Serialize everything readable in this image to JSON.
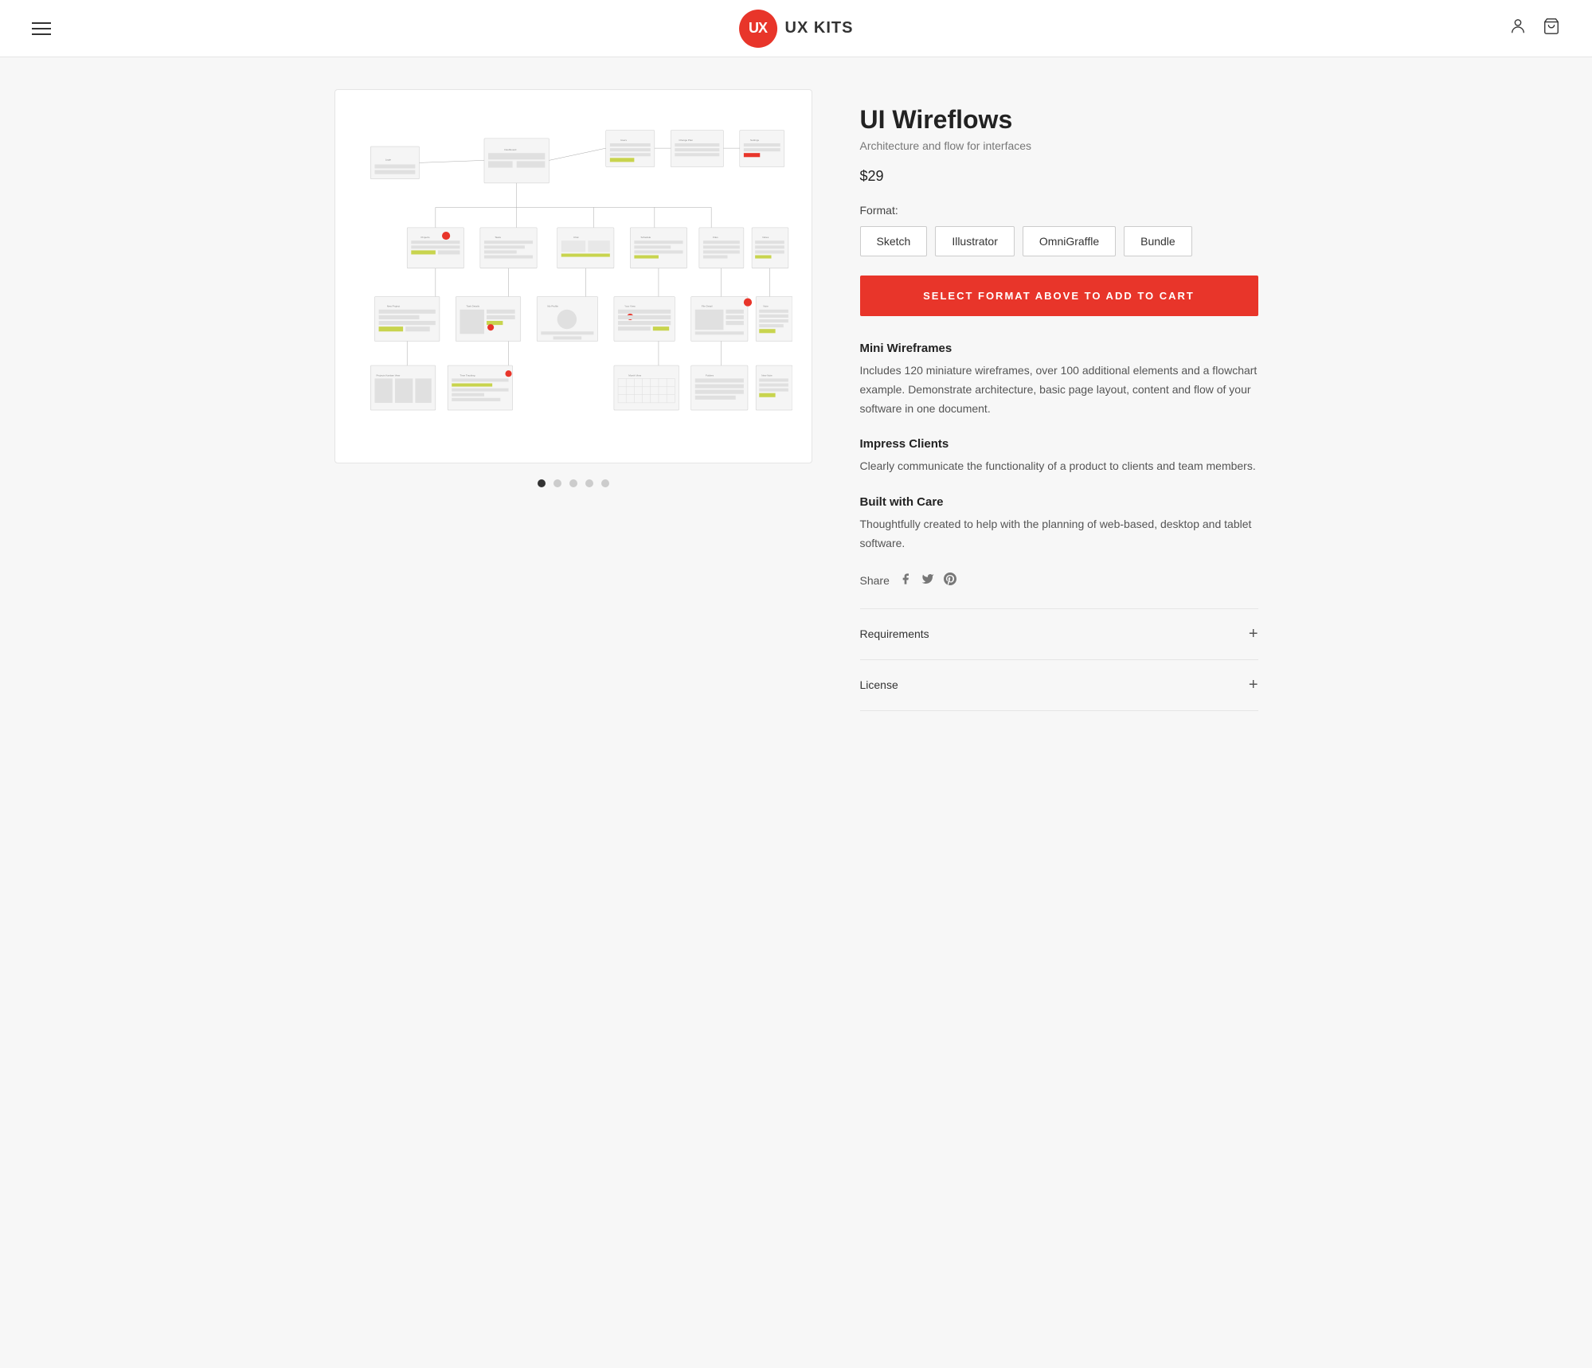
{
  "header": {
    "logo_text": "UX KITS",
    "logo_initials": "UX"
  },
  "product": {
    "title": "UI Wireflows",
    "subtitle": "Architecture and flow for interfaces",
    "price": "$29",
    "format_label": "Format:",
    "formats": [
      "Sketch",
      "Illustrator",
      "OmniGraffle",
      "Bundle"
    ],
    "add_to_cart_label": "SELECT FORMAT ABOVE TO ADD TO CART",
    "features": [
      {
        "title": "Mini Wireframes",
        "description": "Includes 120 miniature wireframes, over 100 additional elements and a flowchart example. Demonstrate architecture, basic page layout, content and flow of your software in one document."
      },
      {
        "title": "Impress Clients",
        "description": "Clearly communicate the functionality of a product to clients and team members."
      },
      {
        "title": "Built with Care",
        "description": "Thoughtfully created to help with the planning of web-based, desktop and tablet software."
      }
    ],
    "share_label": "Share",
    "accordion": [
      {
        "title": "Requirements"
      },
      {
        "title": "License"
      }
    ]
  },
  "dots": {
    "count": 5,
    "active_index": 0
  }
}
